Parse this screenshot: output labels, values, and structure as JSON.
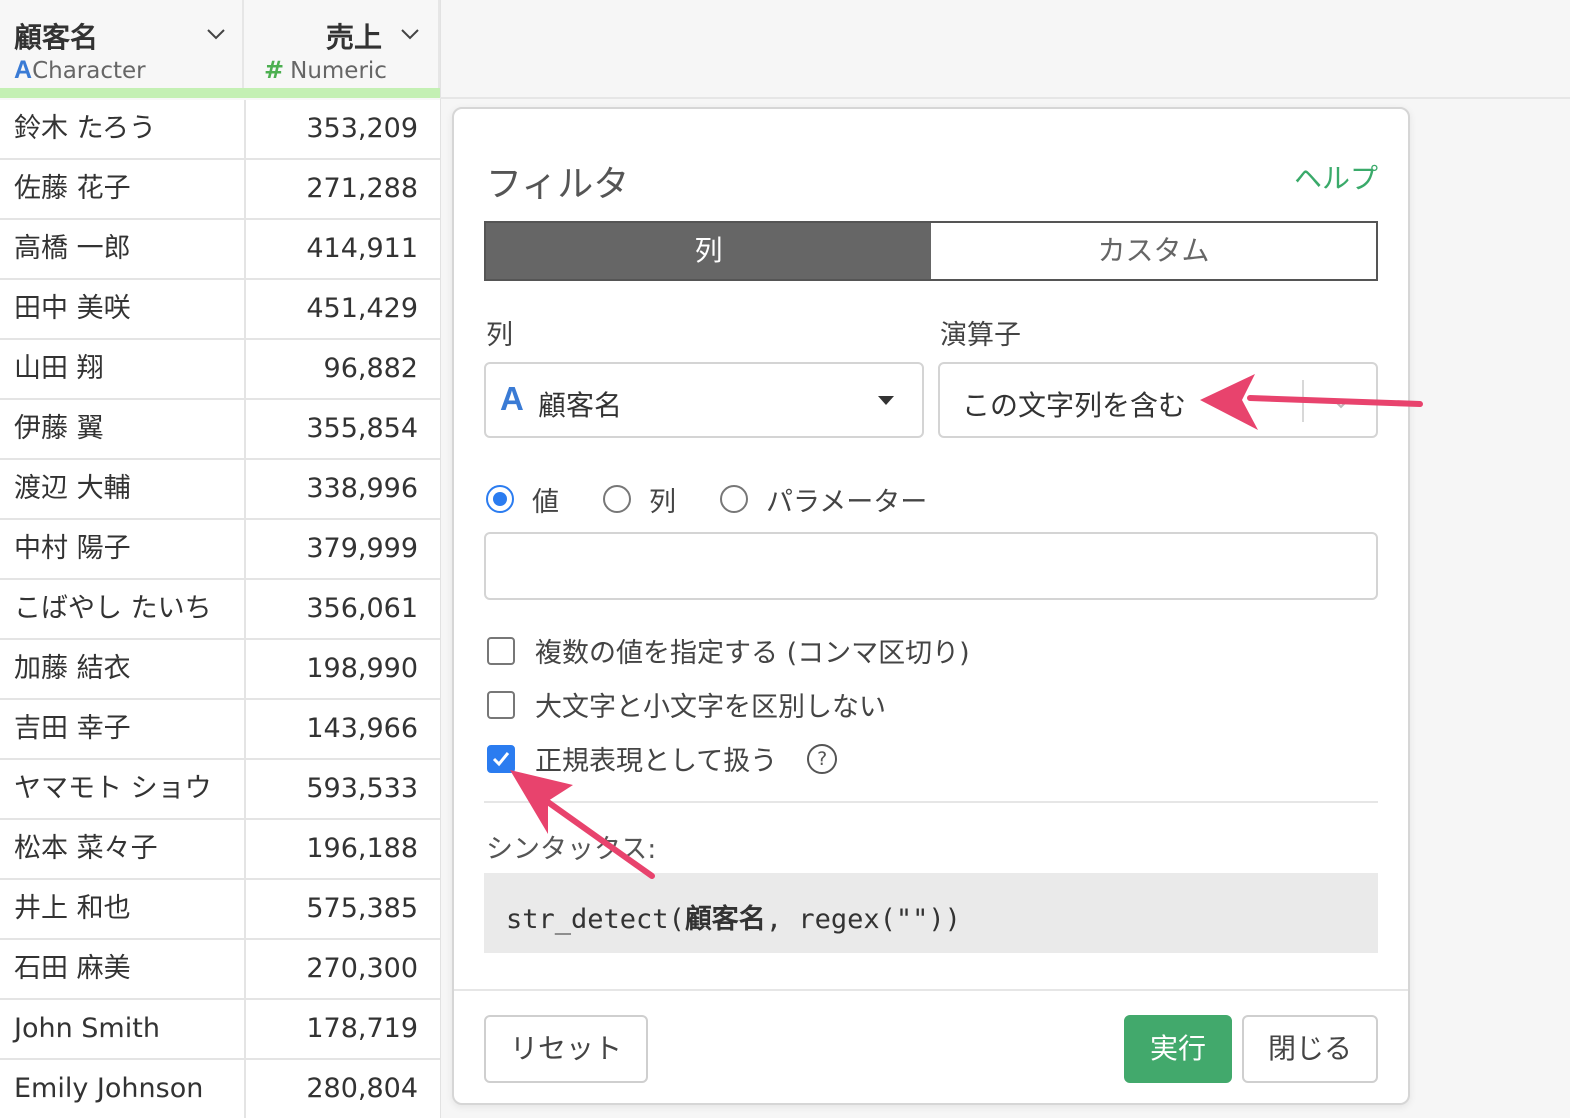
{
  "table": {
    "columns": [
      {
        "name": "顧客名",
        "type_label": "Character",
        "type_icon": "A"
      },
      {
        "name": "売上",
        "type_label": "Numeric",
        "type_icon": "#"
      }
    ],
    "rows": [
      {
        "name": "鈴木 たろう",
        "sales": "353,209"
      },
      {
        "name": "佐藤 花子",
        "sales": "271,288"
      },
      {
        "name": "高橋 一郎",
        "sales": "414,911"
      },
      {
        "name": "田中 美咲",
        "sales": "451,429"
      },
      {
        "name": "山田 翔",
        "sales": "96,882"
      },
      {
        "name": "伊藤 翼",
        "sales": "355,854"
      },
      {
        "name": "渡辺 大輔",
        "sales": "338,996"
      },
      {
        "name": "中村 陽子",
        "sales": "379,999"
      },
      {
        "name": "こばやし たいち",
        "sales": "356,061"
      },
      {
        "name": "加藤 結衣",
        "sales": "198,990"
      },
      {
        "name": "吉田 幸子",
        "sales": "143,966"
      },
      {
        "name": "ヤマモト ショウ",
        "sales": "593,533"
      },
      {
        "name": "松本 菜々子",
        "sales": "196,188"
      },
      {
        "name": "井上 和也",
        "sales": "575,385"
      },
      {
        "name": "石田 麻美",
        "sales": "270,300"
      },
      {
        "name": "John Smith",
        "sales": "178,719"
      },
      {
        "name": "Emily Johnson",
        "sales": "280,804"
      }
    ]
  },
  "dialog": {
    "title": "フィルタ",
    "help_link": "ヘルプ",
    "tabs": {
      "column": "列",
      "custom": "カスタム",
      "active": "column"
    },
    "column_label": "列",
    "operator_label": "演算子",
    "column_select": {
      "type_icon": "A",
      "value": "顧客名"
    },
    "operator_select": {
      "value": "この文字列を含む"
    },
    "radio": {
      "value": "値",
      "column": "列",
      "parameter": "パラメーター",
      "selected": "value"
    },
    "value_input": {
      "value": "",
      "placeholder": ""
    },
    "checkboxes": {
      "multiple": {
        "label": "複数の値を指定する (コンマ区切り)",
        "checked": false
      },
      "ignore_case": {
        "label": "大文字と小文字を区別しない",
        "checked": false
      },
      "regex": {
        "label": "正規表現として扱う",
        "checked": true
      }
    },
    "help_icon": "?",
    "syntax_label": "シンタックス:",
    "syntax": {
      "prefix": "str_detect(",
      "column": "顧客名",
      "suffix": ", regex(\"\"))"
    },
    "buttons": {
      "reset": "リセット",
      "run": "実行",
      "close": "閉じる"
    }
  },
  "colors": {
    "accent_blue": "#2b7cf0",
    "run_green": "#42a96c",
    "help_green": "#3aaa6a",
    "quality_bar": "#c4f0b4",
    "annotation_arrow": "#e8436d"
  }
}
